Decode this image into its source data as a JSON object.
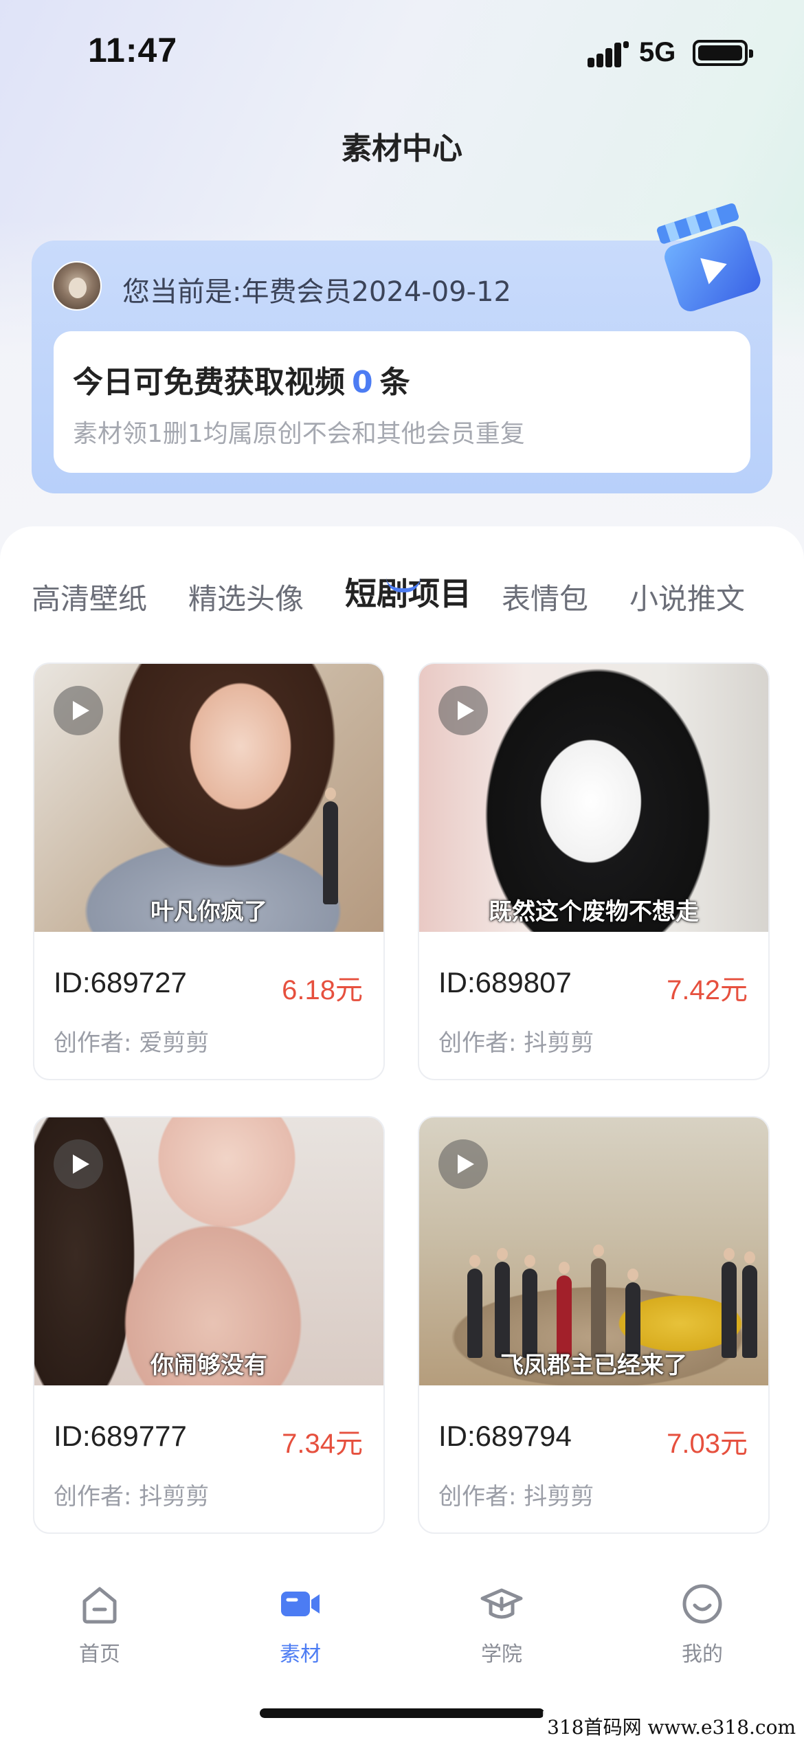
{
  "status_bar": {
    "time": "11:47",
    "network": "5G"
  },
  "header": {
    "title": "素材中心"
  },
  "member": {
    "status_text": "您当前是:年费会员2024-09-12",
    "free_prefix": "今日可免费获取视频",
    "free_count": "0",
    "free_suffix": "条",
    "note": "素材领1删1均属原创不会和其他会员重复"
  },
  "tabs": [
    {
      "label": "高清壁纸",
      "active": false
    },
    {
      "label": "精选头像",
      "active": false
    },
    {
      "label": "短剧项目",
      "active": true
    },
    {
      "label": "表情包",
      "active": false
    },
    {
      "label": "小说推文",
      "active": false
    }
  ],
  "videos": [
    {
      "subtitle": "叶凡你疯了",
      "id": "ID:689727",
      "price": "6.18元",
      "creator": "创作者: 爱剪剪"
    },
    {
      "subtitle": "既然这个废物不想走",
      "id": "ID:689807",
      "price": "7.42元",
      "creator": "创作者: 抖剪剪"
    },
    {
      "subtitle": "你闹够没有",
      "id": "ID:689777",
      "price": "7.34元",
      "creator": "创作者: 抖剪剪"
    },
    {
      "subtitle": "飞凤郡主已经来了",
      "id": "ID:689794",
      "price": "7.03元",
      "creator": "创作者: 抖剪剪"
    }
  ],
  "nav": [
    {
      "label": "首页",
      "icon": "home-icon",
      "active": false
    },
    {
      "label": "素材",
      "icon": "video-camera-icon",
      "active": true
    },
    {
      "label": "学院",
      "icon": "graduation-cap-icon",
      "active": false
    },
    {
      "label": "我的",
      "icon": "smile-icon",
      "active": false
    }
  ],
  "colors": {
    "accent": "#4c7cf3",
    "price": "#e6503e"
  },
  "watermark": "318首码网 www.e318.com"
}
